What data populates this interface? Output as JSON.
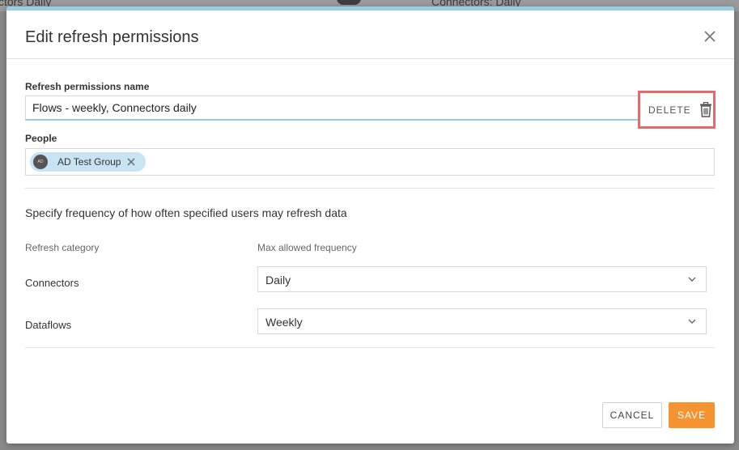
{
  "background": {
    "left_text": "ctors Daily",
    "right_text": "Connectors: Daily"
  },
  "dialog": {
    "title": "Edit refresh permissions",
    "close_icon": "close-icon"
  },
  "name_field": {
    "label": "Refresh permissions name",
    "value": "Flows - weekly, Connectors daily"
  },
  "delete": {
    "label": "DELETE",
    "icon": "trash-icon",
    "highlight_color": "#e26b6b"
  },
  "people": {
    "label": "People",
    "chips": [
      {
        "avatar": "AD",
        "label": "AD Test Group"
      }
    ]
  },
  "frequency": {
    "heading": "Specify frequency of how often specified users may refresh data",
    "col_category": "Refresh category",
    "col_max": "Max allowed frequency",
    "rows": [
      {
        "category": "Connectors",
        "value": "Daily"
      },
      {
        "category": "Dataflows",
        "value": "Weekly"
      }
    ]
  },
  "footer": {
    "cancel_label": "CANCEL",
    "save_label": "SAVE",
    "save_color": "#f59331"
  },
  "colors": {
    "accent": "#99cfe6",
    "chip": "#c8e4f3"
  }
}
